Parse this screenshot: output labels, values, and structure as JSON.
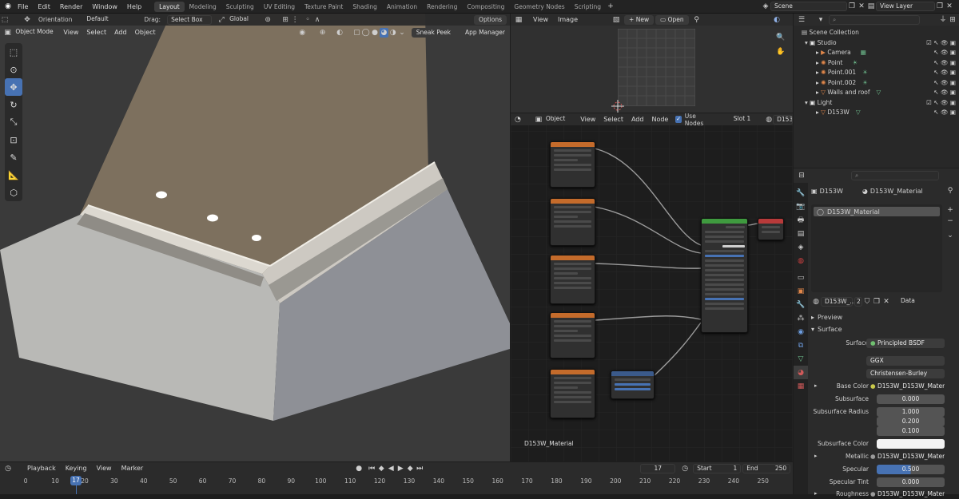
{
  "menu": {
    "items": [
      "File",
      "Edit",
      "Render",
      "Window",
      "Help"
    ],
    "workspaces": [
      "Layout",
      "Modeling",
      "Sculpting",
      "UV Editing",
      "Texture Paint",
      "Shading",
      "Animation",
      "Rendering",
      "Compositing",
      "Geometry Nodes",
      "Scripting"
    ],
    "active_workspace": "Layout",
    "scene": "Scene",
    "view_layer": "View Layer"
  },
  "viewport": {
    "orientation_label": "Orientation",
    "orientation_value": "Default",
    "drag_label": "Drag:",
    "drag_value": "Select Box",
    "transform_space": "Global",
    "options_label": "Options",
    "mode": "Object Mode",
    "menus": [
      "View",
      "Select",
      "Add",
      "Object"
    ],
    "addon_buttons": [
      "Sneak Peek",
      "App Manager"
    ]
  },
  "image_editor": {
    "menus": [
      "View",
      "Image"
    ],
    "new_label": "New",
    "open_label": "Open"
  },
  "node_editor": {
    "object_label": "Object",
    "menus": [
      "View",
      "Select",
      "Add",
      "Node"
    ],
    "use_nodes_label": "Use Nodes",
    "slot_label": "Slot 1",
    "material_short": "D153",
    "material_name_label": "D153W_Material"
  },
  "outliner": {
    "scene_collection": "Scene Collection",
    "items": [
      {
        "label": "Studio",
        "depth": 1,
        "icon": "collection-icon"
      },
      {
        "label": "Camera",
        "depth": 2,
        "icon": "camera-icon"
      },
      {
        "label": "Point",
        "depth": 2,
        "icon": "light-icon"
      },
      {
        "label": "Point.001",
        "depth": 2,
        "icon": "light-icon"
      },
      {
        "label": "Point.002",
        "depth": 2,
        "icon": "light-icon"
      },
      {
        "label": "Walls and roof",
        "depth": 2,
        "icon": "mesh-icon"
      },
      {
        "label": "Light",
        "depth": 1,
        "icon": "collection-icon"
      },
      {
        "label": "D153W",
        "depth": 2,
        "icon": "mesh-icon"
      }
    ]
  },
  "properties": {
    "object_name": "D153W",
    "material_name": "D153W_Material",
    "slot_item": "D153W_Material",
    "datablock_name": "D153W_...",
    "user_count": "2",
    "link_value": "Data",
    "panel_preview": "Preview",
    "panel_surface": "Surface",
    "rows": [
      {
        "label": "Surface",
        "value": "Principled BSDF",
        "kind": "link"
      },
      {
        "label": "",
        "value": "GGX",
        "kind": "enum"
      },
      {
        "label": "",
        "value": "Christensen-Burley",
        "kind": "enum"
      },
      {
        "label": "Base Color",
        "value": "D153W_D153W_Materia...",
        "kind": "link"
      },
      {
        "label": "Subsurface",
        "value": "0.000",
        "kind": "num"
      },
      {
        "label": "Subsurface Radius",
        "value": "1.000",
        "kind": "num"
      },
      {
        "label": "",
        "value": "0.200",
        "kind": "num"
      },
      {
        "label": "",
        "value": "0.100",
        "kind": "num"
      },
      {
        "label": "Subsurface Color",
        "value": "",
        "kind": "color"
      },
      {
        "label": "Metallic",
        "value": "D153W_D153W_Materia...",
        "kind": "link"
      },
      {
        "label": "Specular",
        "value": "0.500",
        "kind": "slider"
      },
      {
        "label": "Specular Tint",
        "value": "0.000",
        "kind": "num"
      },
      {
        "label": "Roughness",
        "value": "D153W_D153W_Materia...",
        "kind": "link"
      }
    ]
  },
  "timeline": {
    "menus": [
      "Playback",
      "Keying",
      "View",
      "Marker"
    ],
    "current_frame": "17",
    "start_label": "Start",
    "start_value": "1",
    "end_label": "End",
    "end_value": "250",
    "ticks": [
      "0",
      "10",
      "20",
      "30",
      "40",
      "50",
      "60",
      "70",
      "80",
      "90",
      "100",
      "110",
      "120",
      "130",
      "140",
      "150",
      "160",
      "170",
      "180",
      "190",
      "200",
      "210",
      "220",
      "230",
      "240",
      "250"
    ]
  },
  "colors": {
    "accent": "#4772b3",
    "ceiling": "#7d705e",
    "wall_left": "#b9b9b6",
    "wall_right": "#8e9096",
    "node_texture_header": "#c46b2b",
    "node_bsdf_header": "#3f9a3f",
    "node_output_header": "#b83a3a"
  }
}
